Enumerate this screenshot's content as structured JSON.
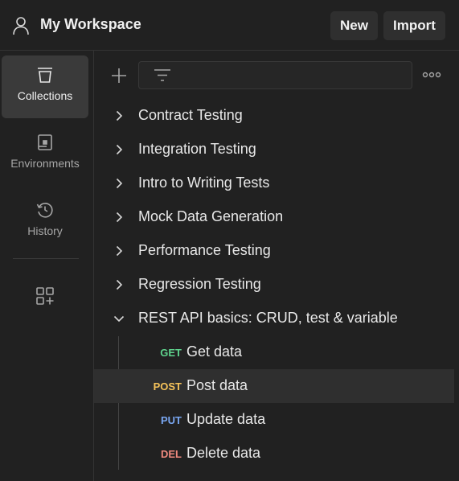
{
  "header": {
    "title": "My Workspace",
    "new_label": "New",
    "import_label": "Import"
  },
  "sidebar": {
    "items": [
      {
        "label": "Collections",
        "icon": "collections-icon",
        "active": true
      },
      {
        "label": "Environments",
        "icon": "environments-icon",
        "active": false
      },
      {
        "label": "History",
        "icon": "history-icon",
        "active": false
      }
    ],
    "extra_icon": "add-widget-icon"
  },
  "collections": [
    {
      "label": "Contract Testing",
      "expanded": false
    },
    {
      "label": "Integration Testing",
      "expanded": false
    },
    {
      "label": "Intro to Writing Tests",
      "expanded": false
    },
    {
      "label": "Mock Data Generation",
      "expanded": false
    },
    {
      "label": "Performance Testing",
      "expanded": false
    },
    {
      "label": "Regression Testing",
      "expanded": false
    },
    {
      "label": "REST API basics: CRUD, test & variable",
      "expanded": true
    }
  ],
  "requests": [
    {
      "method": "GET",
      "label": "Get data",
      "color": "#5fd38d"
    },
    {
      "method": "POST",
      "label": "Post data",
      "color": "#f6c35a",
      "selected": true
    },
    {
      "method": "PUT",
      "label": "Update data",
      "color": "#79a7f2"
    },
    {
      "method": "DEL",
      "label": "Delete data",
      "color": "#f08a7f"
    }
  ],
  "colors": {
    "background": "#212121",
    "active_item": "#3a3a3a",
    "selected_row": "#2f2f2f"
  }
}
